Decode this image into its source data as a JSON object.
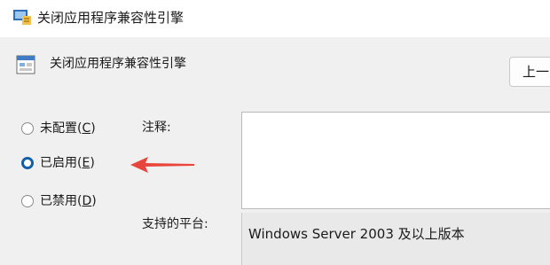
{
  "window": {
    "title": "关闭应用程序兼容性引擎"
  },
  "policy": {
    "name": "关闭应用程序兼容性引擎",
    "prev_button_label": "上一"
  },
  "options": {
    "not_configured": {
      "text": "未配置(",
      "key": "C",
      "close": ")"
    },
    "enabled": {
      "text": "已启用(",
      "key": "E",
      "close": ")"
    },
    "disabled": {
      "text": "已禁用(",
      "key": "D",
      "close": ")"
    },
    "selected": "enabled"
  },
  "fields": {
    "comment_label": "注释:",
    "comment_value": "",
    "platform_label": "支持的平台:",
    "platform_value": "Windows Server 2003 及以上版本"
  },
  "annotation": {
    "arrow_color": "#e8453c"
  },
  "colors": {
    "radio_selected": "#1360a8"
  }
}
